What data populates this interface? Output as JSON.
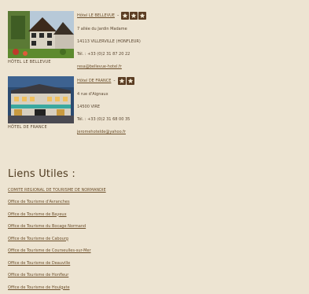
{
  "hotels": [
    {
      "caption": "HÔTEL LE BELLEVUE",
      "name": "Hôtel LE BELLEVUE",
      "separator": "-",
      "stars": 3,
      "address1": "7 allée du Jardin Madame",
      "address2": "14113 VILLERVILLE (HONFLEUR)",
      "phone": "Tél. : +33 (0)2 31 87 20 22",
      "email": "resa@bellevue-hotel.fr",
      "star_color": "#5b3d23"
    },
    {
      "caption": "HÔTEL DE FRANCE",
      "name": "Hôtel DE FRANCE",
      "separator": "-",
      "stars": 2,
      "address1": "4 rue d'Aignaux",
      "address2": "14500 VIRE",
      "phone": "Tél. : +33 (0)2 31 68 00 35",
      "email": "jeromehotelde@yahoo.fr",
      "star_color": "#5b3d23"
    }
  ],
  "links_title": "Liens Utiles :",
  "links": [
    "COMITE REGIONAL DE TOURISME DE NORMANDIE",
    "Office de Tourisme d'Avranches",
    "Office de Tourisme de Bayeux",
    "Office de Tourisme du Bocage Normand",
    "Office de Tourisme de Cabourg",
    "Office de Tourisme de Courseulles-sur-Mer",
    "Office de Tourisme de Deauville",
    "Office de Tourisme de Honfleur",
    "Office de Tourisme de Houlgate"
  ],
  "colors": {
    "background": "#ede4d2",
    "text": "#5a4630",
    "link": "#6b4e2a"
  }
}
